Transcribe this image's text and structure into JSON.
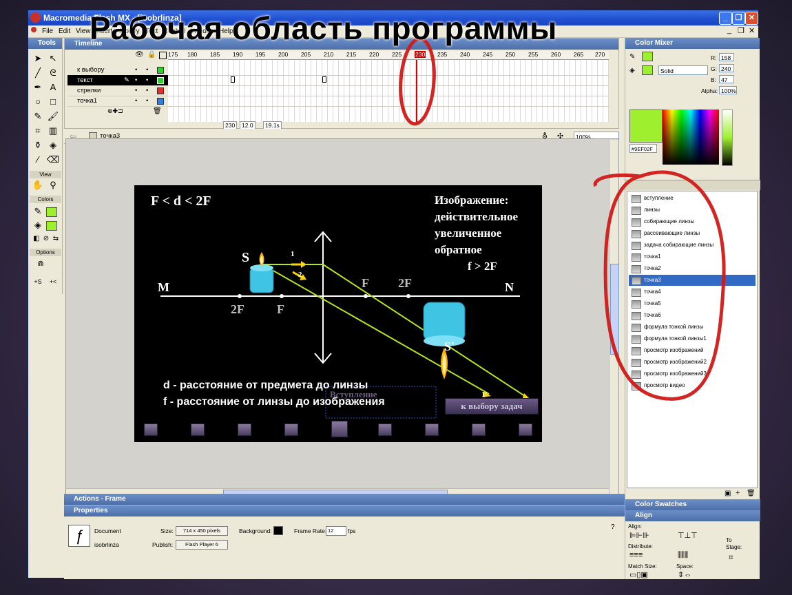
{
  "overlay_title": "Рабочая область программы",
  "window": {
    "title": "Macromedia Flash MX - [isobrlinza]",
    "buttons": [
      "_",
      "❐",
      "✕"
    ]
  },
  "menu": [
    "File",
    "Edit",
    "View",
    "Insert",
    "Modify",
    "Text",
    "Control",
    "Window",
    "Help"
  ],
  "tools": {
    "header": "Tools",
    "view_label": "View",
    "colors_label": "Colors",
    "options_label": "Options"
  },
  "timeline": {
    "header": "Timeline",
    "ruler": [
      "175",
      "180",
      "185",
      "190",
      "195",
      "200",
      "205",
      "210",
      "215",
      "220",
      "225",
      "230",
      "235",
      "240",
      "245",
      "250",
      "255",
      "260",
      "265",
      "270"
    ],
    "layers": [
      {
        "name": "к выбору"
      },
      {
        "name": "текст"
      },
      {
        "name": "стрелки"
      },
      {
        "name": "точка1"
      }
    ],
    "current_frame": "230",
    "fps": "12.0 fps",
    "time": "19.1s"
  },
  "edit_bar": {
    "scene": "точка3",
    "zoom": "100%"
  },
  "stage": {
    "condition": "F < d < 2F",
    "image_title": "Изображение:",
    "image_props": [
      "действительное",
      "увеличенное",
      "обратное"
    ],
    "f_cond": "f > 2F",
    "S": "S",
    "S_prime": "S'",
    "M": "M",
    "N": "N",
    "F_right": "F",
    "twoF_right": "2F",
    "twoF_left": "2F",
    "F_left": "F",
    "ray1": "1",
    "ray2": "2",
    "ray1_end": "1'",
    "d_def": "d - расстояние от предмета до линзы",
    "f_def": "f - расстояние от линзы до изображения",
    "intro_btn": "Вступление",
    "choose_btn": "к выбору задач"
  },
  "color_mixer": {
    "header": "Color Mixer",
    "fill_type": "Solid",
    "R_label": "R:",
    "R": "158",
    "G_label": "G:",
    "G": "240",
    "B_label": "B:",
    "B": "47",
    "alpha_label": "Alpha:",
    "alpha": "100%",
    "hex": "#9EF02F",
    "swatch_color": "#9EF02F"
  },
  "library": {
    "items": [
      "вступление",
      "линзы",
      "собирающие линзы",
      "рассеивающие линзы",
      "задача собирающие линзы",
      "точка1",
      "точка2",
      "точка3",
      "точка4",
      "точка5",
      "точка6",
      "формула тонкой линзы",
      "формула тонкой линзы1",
      "просмотр изображений",
      "просмотр изображений2",
      "просмотр изображений3",
      "просмотр видео"
    ],
    "selected": "точка3"
  },
  "color_swatches": {
    "header": "Color Swatches"
  },
  "align": {
    "header": "Align",
    "align_label": "Align:",
    "distribute_label": "Distribute:",
    "match_label": "Match Size:",
    "space_label": "Space:",
    "to_stage": "To",
    "stage_label": "Stage:"
  },
  "actions": {
    "header": "Actions - Frame"
  },
  "properties": {
    "header": "Properties",
    "doc_type": "Document",
    "doc_name": "isobrlinza",
    "size_label": "Size:",
    "size": "714 x 450 pixels",
    "publish_label": "Publish:",
    "publish": "Flash Player 6",
    "bg_label": "Background:",
    "fr_label": "Frame Rate:",
    "frame_rate": "12",
    "fps_unit": "fps"
  }
}
